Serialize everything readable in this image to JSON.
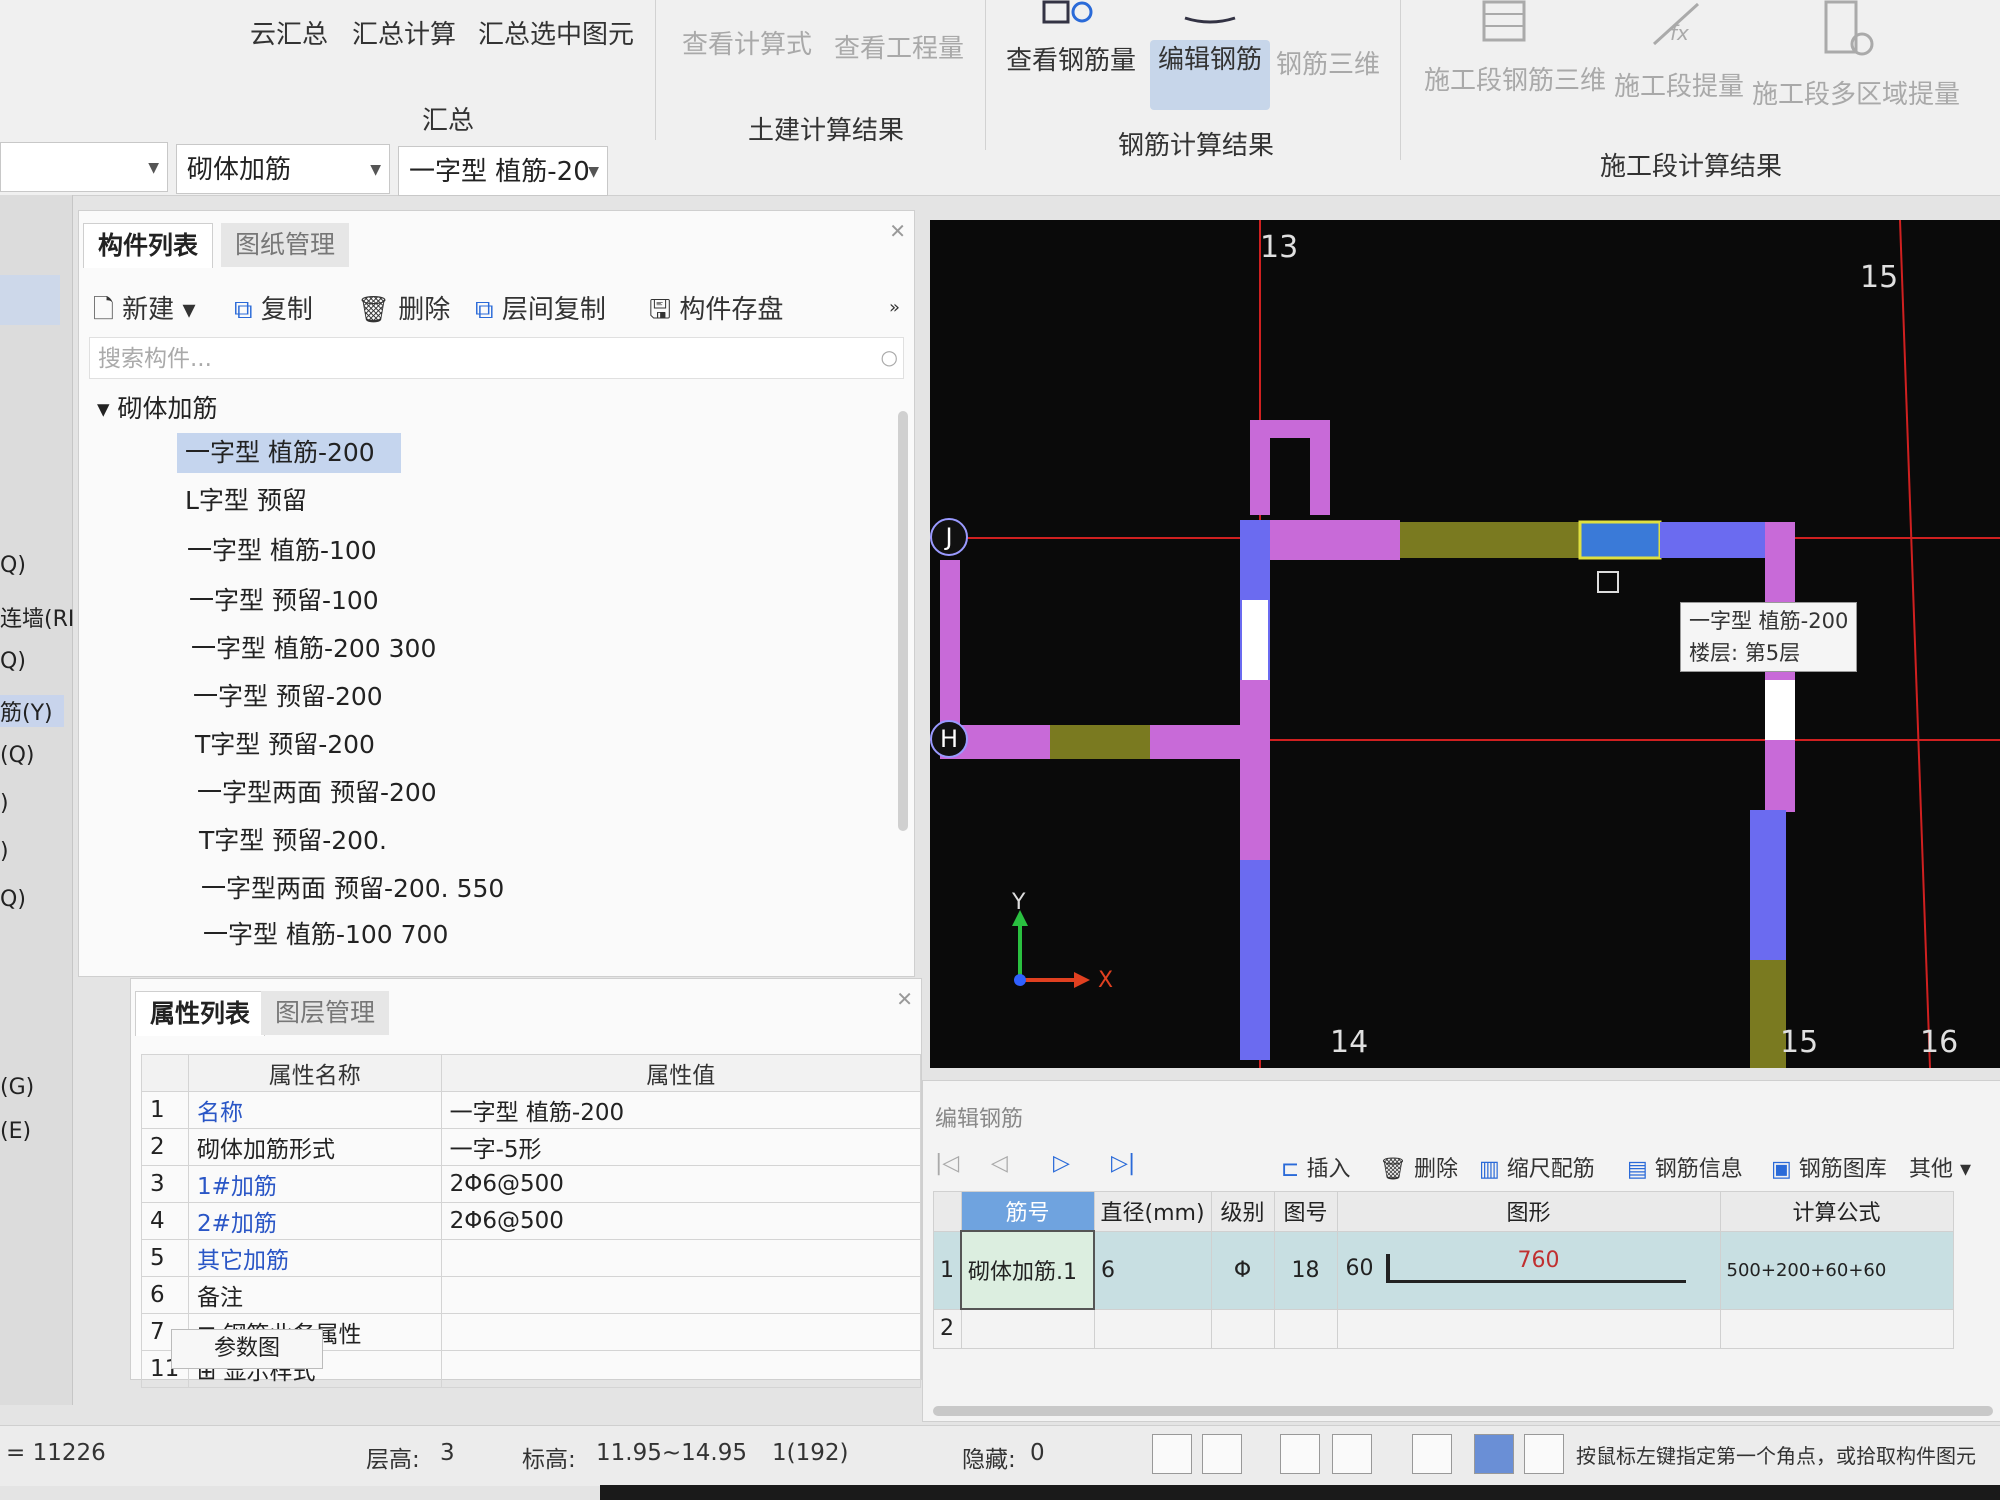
{
  "ribbon": {
    "buttons": {
      "cloud_summary": "云汇总",
      "summary_calc": "汇总计算",
      "summary_selected": "汇总选中图元",
      "view_formula": "查看计算式",
      "view_quantity": "查看工程量",
      "view_rebar_qty": "查看钢筋量",
      "edit_rebar": "编辑钢筋",
      "rebar_3d": "钢筋三维",
      "stage_rebar_3d": "施工段钢筋三维",
      "stage_takeoff": "施工段提量",
      "stage_multi_area": "施工段多区域提量"
    },
    "groups": {
      "summary": "汇总",
      "civil_result": "土建计算结果",
      "rebar_result": "钢筋计算结果",
      "stage_result": "施工段计算结果"
    },
    "selectors": {
      "category": "砌体加筋",
      "component": "一字型 植筋-20"
    }
  },
  "left_strip": {
    "items": [
      "Q)",
      "连墙(RI",
      "Q)",
      "筋(Y)",
      "(Q)",
      ")",
      ")",
      "Q)",
      "(G)",
      "(E)"
    ]
  },
  "component_panel": {
    "tabs": [
      "构件列表",
      "图纸管理"
    ],
    "toolbar": {
      "new": "新建",
      "copy": "复制",
      "delete": "删除",
      "floor_copy": "层间复制",
      "save_component": "构件存盘"
    },
    "search_placeholder": "搜索构件...",
    "tree_root": "砌体加筋",
    "items": [
      "一字型 植筋-200",
      "L字型 预留",
      "一字型 植筋-100",
      "一字型 预留-100",
      "一字型 植筋-200 300",
      "一字型 预留-200",
      "T字型 预留-200",
      "一字型两面 预留-200",
      "T字型 预留-200.",
      "一字型两面 预留-200. 550",
      "一字型 植筋-100 700"
    ],
    "selected_index": 0
  },
  "property_panel": {
    "tabs": [
      "属性列表",
      "图层管理"
    ],
    "headers": [
      "属性名称",
      "属性值"
    ],
    "rows": [
      {
        "no": "1",
        "name": "名称",
        "value": "一字型 植筋-200",
        "blue": true
      },
      {
        "no": "2",
        "name": "砌体加筋形式",
        "value": "一字-5形",
        "blue": false
      },
      {
        "no": "3",
        "name": "1#加筋",
        "value": "2Φ6@500",
        "blue": true
      },
      {
        "no": "4",
        "name": "2#加筋",
        "value": "2Φ6@500",
        "blue": true
      },
      {
        "no": "5",
        "name": "其它加筋",
        "value": "",
        "blue": true
      },
      {
        "no": "6",
        "name": "备注",
        "value": "",
        "blue": false
      },
      {
        "no": "7",
        "name": "钢筋业务属性",
        "value": "",
        "blue": false
      },
      {
        "no": "11",
        "name": "显示样式",
        "value": "",
        "blue": false
      }
    ],
    "param_button": "参数图"
  },
  "viewport": {
    "axis_top": [
      "13",
      "15"
    ],
    "axis_bottom": [
      "14",
      "15",
      "16"
    ],
    "axis_left": [
      "J",
      "H"
    ],
    "tooltip_line1": "一字型 植筋-200",
    "tooltip_line2": "楼层: 第5层",
    "x_label": "X",
    "y_label": "Y",
    "colors": {
      "background": "#0a0a0a",
      "wall_purple": "#c86ad8",
      "wall_blue": "#6b6bf0",
      "wall_olive": "#7a7a20",
      "grid_red": "#d02020",
      "selected": "#3a7ad8"
    }
  },
  "edit_rebar": {
    "title": "编辑钢筋",
    "toolbar": {
      "insert": "插入",
      "delete": "删除",
      "scale_rebar": "缩尺配筋",
      "rebar_info": "钢筋信息",
      "rebar_library": "钢筋图库",
      "other": "其他"
    },
    "headers": [
      "筋号",
      "直径(mm)",
      "级别",
      "图号",
      "图形",
      "计算公式"
    ],
    "rows": [
      {
        "no": "1",
        "name": "砌体加筋.1",
        "diameter": "6",
        "grade": "Φ",
        "figure_no": "18",
        "hook": "60",
        "length": "760",
        "formula": "500+200+60+60"
      }
    ],
    "empty_row_no": "2"
  },
  "status": {
    "total": "= 11226",
    "floor_height_label": "层高:",
    "floor_height": "3",
    "elevation_label": "标高:",
    "elevation": "11.95~14.95",
    "count": "1(192)",
    "hidden_label": "隐藏:",
    "hidden": "0",
    "hint": "按鼠标左键指定第一个角点，或拾取构件图元"
  }
}
